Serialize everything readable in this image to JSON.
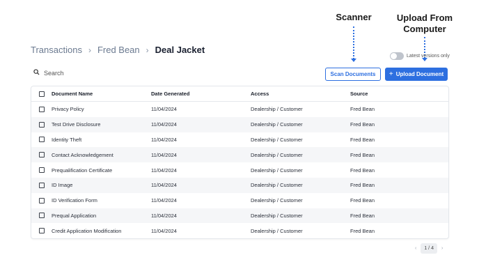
{
  "annotations": {
    "scanner": "Scanner",
    "upload_line1": "Upload From",
    "upload_line2": "Computer"
  },
  "breadcrumb": {
    "items": [
      "Transactions",
      "Fred Bean"
    ],
    "current": "Deal Jacket",
    "separator": "›"
  },
  "toggle": {
    "label": "Latest versions only",
    "on": false
  },
  "search": {
    "placeholder": "Search"
  },
  "buttons": {
    "scan": "Scan Documents",
    "upload": "Upload Document",
    "upload_icon": "+"
  },
  "table": {
    "columns": [
      "Document Name",
      "Date Generated",
      "Access",
      "Source"
    ],
    "rows": [
      [
        "Privacy Policy",
        "11/04/2024",
        "Dealership / Customer",
        "Fred Bean"
      ],
      [
        "Test Drive Disclosure",
        "11/04/2024",
        "Dealership / Customer",
        "Fred Bean"
      ],
      [
        "Identity Theft",
        "11/04/2024",
        "Dealership / Customer",
        "Fred Bean"
      ],
      [
        "Contact Acknowledgement",
        "11/04/2024",
        "Dealership / Customer",
        "Fred Bean"
      ],
      [
        "Prequalification Certificate",
        "11/04/2024",
        "Dealership / Customer",
        "Fred Bean"
      ],
      [
        "ID Image",
        "11/04/2024",
        "Dealership / Customer",
        "Fred Bean"
      ],
      [
        "ID Verification Form",
        "11/04/2024",
        "Dealership / Customer",
        "Fred Bean"
      ],
      [
        "Prequal Application",
        "11/04/2024",
        "Dealership / Customer",
        "Fred Bean"
      ],
      [
        "Credit Application Modification",
        "11/04/2024",
        "Dealership / Customer",
        "Fred Bean"
      ]
    ]
  },
  "pagination": {
    "label": "1 / 4",
    "prev_icon": "‹",
    "next_icon": "›"
  },
  "colors": {
    "accent": "#2d6fe0",
    "row_alt": "#f5f6f8",
    "breadcrumb_link": "#6b7a90"
  }
}
